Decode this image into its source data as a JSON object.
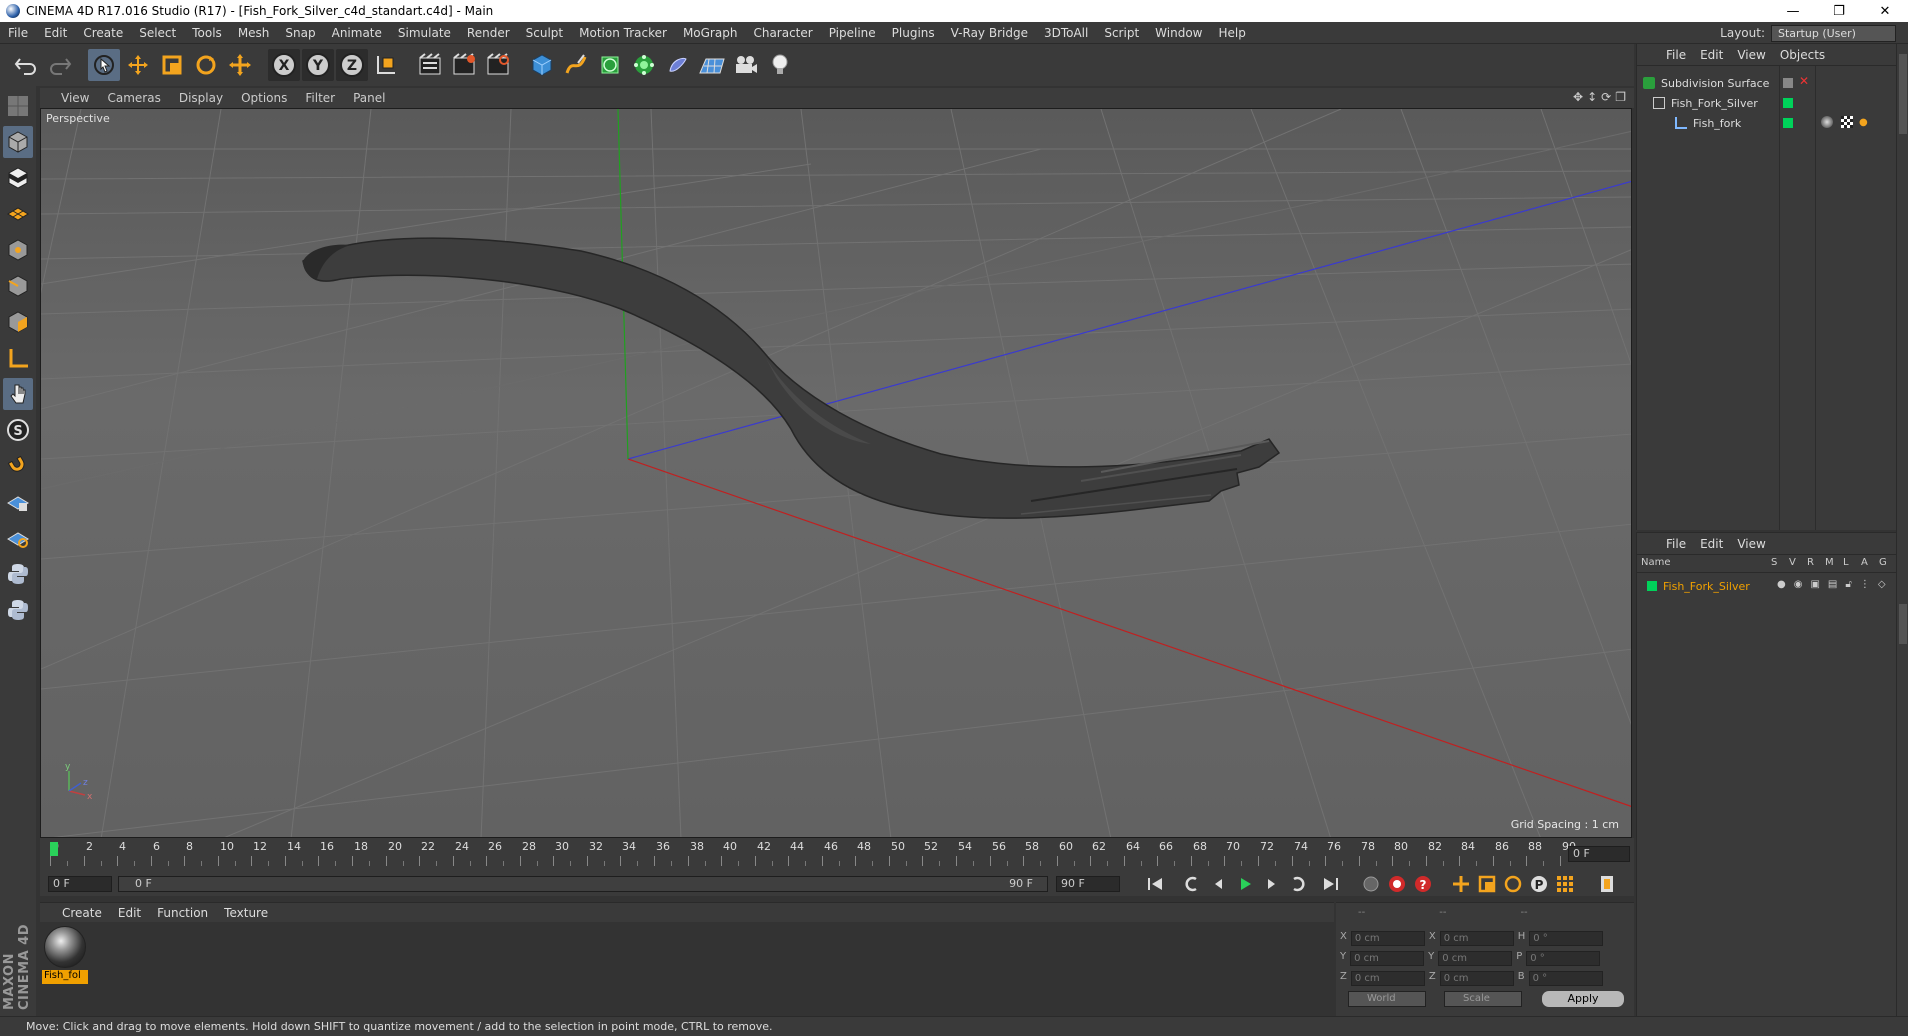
{
  "window": {
    "title": "CINEMA 4D R17.016 Studio (R17) - [Fish_Fork_Silver_c4d_standart.c4d] - Main",
    "controls": [
      "—",
      "❐",
      "✕"
    ]
  },
  "menubar": {
    "items": [
      "File",
      "Edit",
      "Create",
      "Select",
      "Tools",
      "Mesh",
      "Snap",
      "Animate",
      "Simulate",
      "Render",
      "Sculpt",
      "Motion Tracker",
      "MoGraph",
      "Character",
      "Pipeline",
      "Plugins",
      "V-Ray Bridge",
      "3DToAll",
      "Script",
      "Window",
      "Help"
    ],
    "layout_label": "Layout:",
    "layout_value": "Startup (User)"
  },
  "toolbar": {
    "axis_x": "X",
    "axis_y": "Y",
    "axis_z": "Z"
  },
  "viewport": {
    "menu": [
      "View",
      "Cameras",
      "Display",
      "Options",
      "Filter",
      "Panel"
    ],
    "label": "Perspective",
    "grid_spacing": "Grid Spacing : 1 cm"
  },
  "timeline": {
    "ticks": [
      "0",
      "2",
      "4",
      "6",
      "8",
      "10",
      "12",
      "14",
      "16",
      "18",
      "20",
      "22",
      "24",
      "26",
      "28",
      "30",
      "32",
      "34",
      "36",
      "38",
      "40",
      "42",
      "44",
      "46",
      "48",
      "50",
      "52",
      "54",
      "56",
      "58",
      "60",
      "62",
      "64",
      "66",
      "68",
      "70",
      "72",
      "74",
      "76",
      "78",
      "80",
      "82",
      "84",
      "86",
      "88",
      "90"
    ],
    "current_frame": "0 F",
    "start_field": "0 F",
    "range_start": "0 F",
    "range_end": "90 F",
    "end_field": "90 F"
  },
  "material_manager": {
    "menu": [
      "Create",
      "Edit",
      "Function",
      "Texture"
    ],
    "material_name": "Fish_fol"
  },
  "coordinates": {
    "header": [
      "--",
      "--",
      "--"
    ],
    "rows": [
      {
        "a": "X",
        "v1": "0 cm",
        "b": "X",
        "v2": "0 cm",
        "c": "H",
        "v3": "0 °"
      },
      {
        "a": "Y",
        "v1": "0 cm",
        "b": "Y",
        "v2": "0 cm",
        "c": "P",
        "v3": "0 °"
      },
      {
        "a": "Z",
        "v1": "0 cm",
        "b": "Z",
        "v2": "0 cm",
        "c": "B",
        "v3": "0 °"
      }
    ],
    "mode1": "World",
    "mode2": "Scale",
    "apply": "Apply"
  },
  "object_manager": {
    "menu": [
      "File",
      "Edit",
      "View",
      "Objects"
    ],
    "objects": [
      {
        "name": "Subdivision Surface"
      },
      {
        "name": "Fish_Fork_Silver"
      },
      {
        "name": "Fish_fork"
      }
    ]
  },
  "attribute_manager": {
    "menu": [
      "File",
      "Edit",
      "View"
    ],
    "columns": [
      "Name",
      "S",
      "V",
      "R",
      "M",
      "L",
      "A",
      "G"
    ],
    "selected_object": "Fish_Fork_Silver"
  },
  "status": {
    "text": "Move: Click and drag to move elements. Hold down SHIFT to quantize movement / add to the selection in point mode, CTRL to remove."
  },
  "branding": {
    "maxon": "MAXON CINEMA 4D"
  },
  "colors": {
    "accent_green": "#00d25a",
    "material_label": "#f0a000",
    "selected_text": "#f0a000"
  }
}
